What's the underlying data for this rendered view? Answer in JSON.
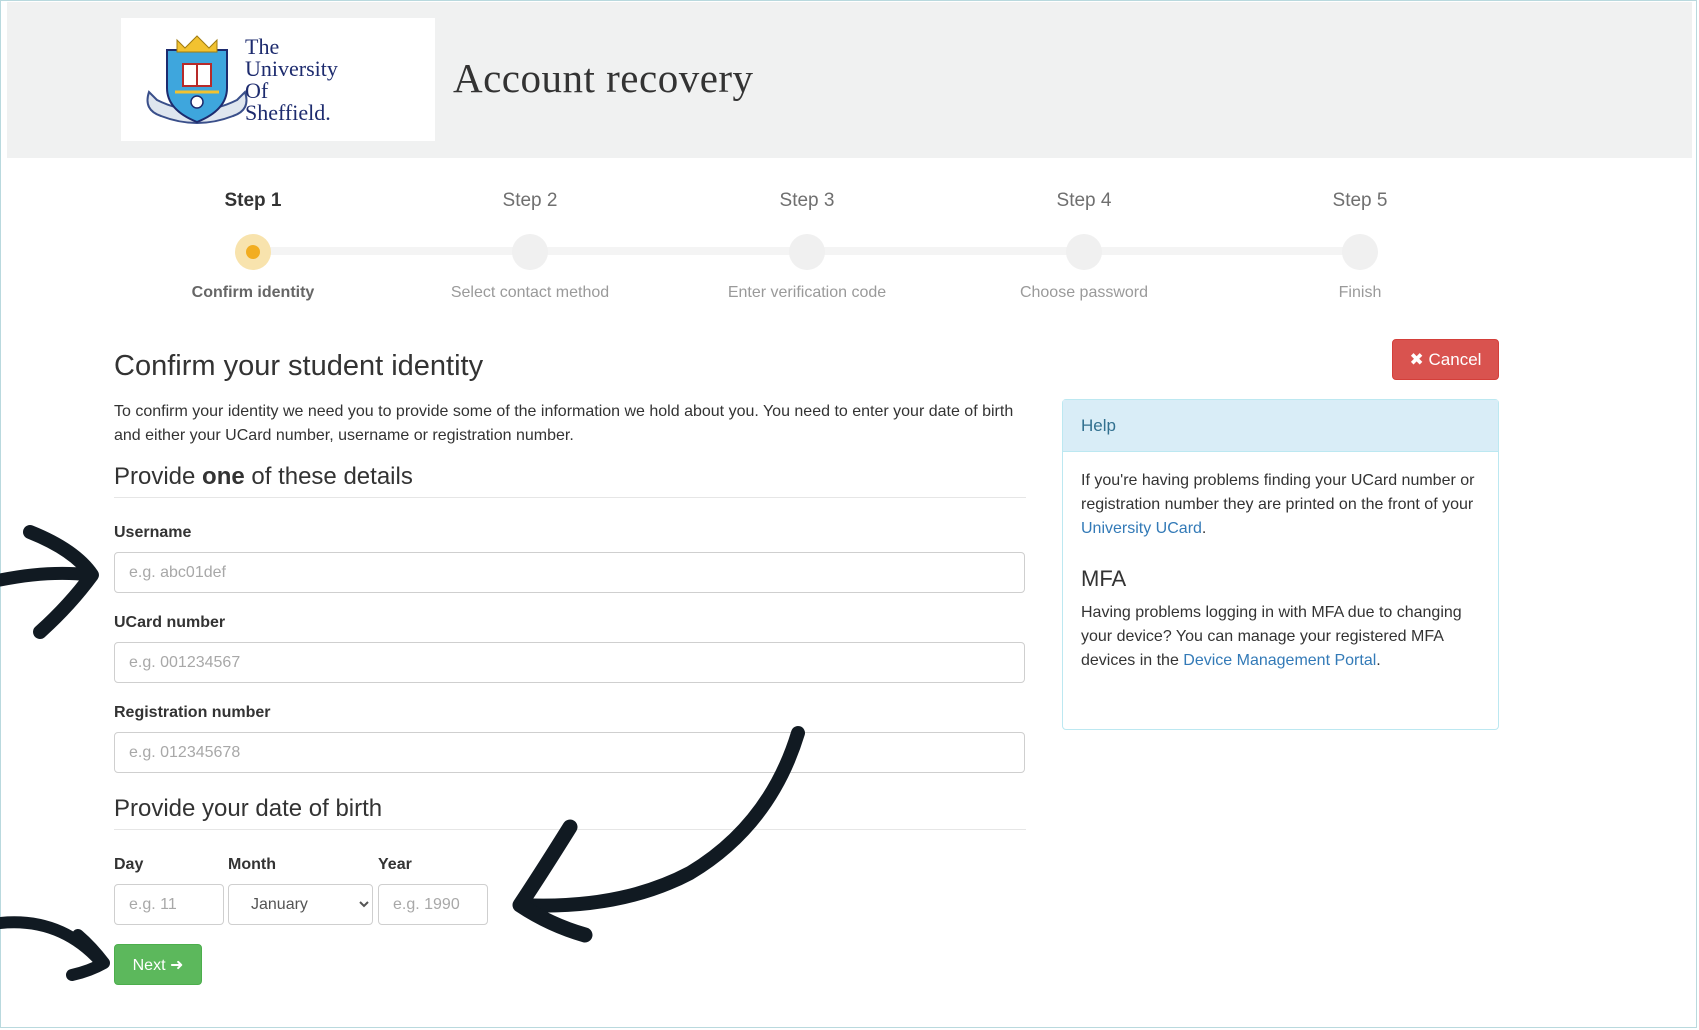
{
  "header": {
    "logo_lines": [
      "The",
      "University",
      "Of",
      "Sheffield."
    ],
    "title": "Account recovery"
  },
  "steps": [
    {
      "title": "Step 1",
      "label": "Confirm identity",
      "state": "active"
    },
    {
      "title": "Step 2",
      "label": "Select contact method",
      "state": "pending"
    },
    {
      "title": "Step 3",
      "label": "Enter verification code",
      "state": "pending"
    },
    {
      "title": "Step 4",
      "label": "Choose password",
      "state": "pending"
    },
    {
      "title": "Step 5",
      "label": "Finish",
      "state": "pending"
    }
  ],
  "form": {
    "heading": "Confirm your student identity",
    "intro": "To confirm your identity we need you to provide some of the information we hold about you. You need to enter your date of birth and either your UCard number, username or registration number.",
    "details_heading_pre": "Provide ",
    "details_heading_bold": "one",
    "details_heading_post": " of these details",
    "username_label": "Username",
    "username_placeholder": "e.g. abc01def",
    "ucard_label": "UCard number",
    "ucard_placeholder": "e.g. 001234567",
    "registration_label": "Registration number",
    "registration_placeholder": "e.g. 012345678",
    "dob_heading": "Provide your date of birth",
    "day_label": "Day",
    "day_placeholder": "e.g. 11",
    "month_label": "Month",
    "month_selected": "January",
    "year_label": "Year",
    "year_placeholder": "e.g. 1990",
    "next_label": "Next",
    "cancel_label": "Cancel"
  },
  "help": {
    "title": "Help",
    "ucard_text": "If you're having problems finding your UCard number or registration number they are printed on the front of your ",
    "ucard_link": "University UCard",
    "ucard_end": ".",
    "mfa_heading": "MFA",
    "mfa_text": "Having problems logging in with MFA due to changing your device? You can manage your registered MFA devices in the ",
    "mfa_link": "Device Management Portal",
    "mfa_end": "."
  },
  "colors": {
    "active_step": "#f2ad20",
    "next_button": "#5cb85c",
    "cancel_button": "#d9534f",
    "help_header": "#d9edf7",
    "link": "#337ab7",
    "annotation_arrow": "#111a22"
  },
  "icons": [
    "university-crest-icon",
    "close-icon",
    "arrow-right-icon",
    "chevron-down-icon"
  ]
}
